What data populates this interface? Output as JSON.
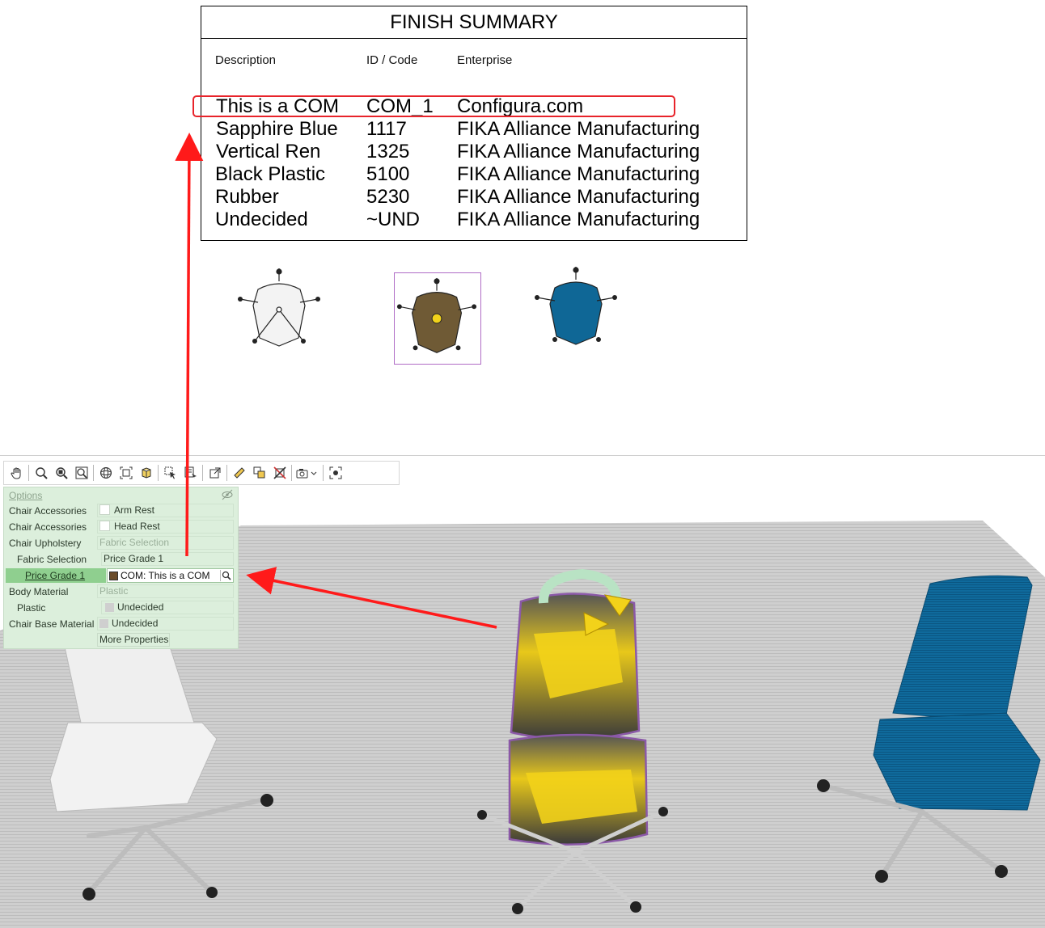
{
  "summary": {
    "title": "FINISH SUMMARY",
    "headers": {
      "description": "Description",
      "id_code": "ID / Code",
      "enterprise": "Enterprise"
    },
    "rows": [
      {
        "description": "This is a COM",
        "id": "COM_1",
        "enterprise": "Configura.com"
      },
      {
        "description": "Sapphire Blue",
        "id": "1117",
        "enterprise": "FIKA Alliance Manufacturing"
      },
      {
        "description": "Vertical Ren",
        "id": "1325",
        "enterprise": "FIKA Alliance Manufacturing"
      },
      {
        "description": "Black Plastic",
        "id": "5100",
        "enterprise": "FIKA Alliance Manufacturing"
      },
      {
        "description": "Rubber",
        "id": "5230",
        "enterprise": "FIKA Alliance Manufacturing"
      },
      {
        "description": "Undecided",
        "id": "~UND",
        "enterprise": "FIKA Alliance Manufacturing"
      }
    ],
    "highlight_color": "#e8232a"
  },
  "thumbnails": [
    {
      "name": "white-chair",
      "color": "#f2f2f2"
    },
    {
      "name": "brown-chair",
      "color": "#6f5a35",
      "selected": true
    },
    {
      "name": "blue-chair",
      "color": "#0f6796"
    }
  ],
  "toolbar": {
    "icons": [
      "hand-icon",
      "zoom-icon",
      "zoom-window-icon",
      "zoom-extents-icon",
      "orbit-icon",
      "fit-selection-icon",
      "view-cube-icon",
      "select-arrow-icon",
      "select-filter-icon",
      "stretch-icon",
      "measure-icon",
      "copy-icon",
      "delete-icon",
      "camera-icon",
      "focus-icon"
    ]
  },
  "options": {
    "header": "Options",
    "rows": [
      {
        "label": "Chair Accessories",
        "value": "Arm Rest",
        "kind": "checkbox"
      },
      {
        "label": "Chair Accessories",
        "value": "Head Rest",
        "kind": "checkbox"
      },
      {
        "label": "Chair Upholstery",
        "value": "Fabric Selection",
        "kind": "muted"
      },
      {
        "label": "Fabric Selection",
        "value": "Price Grade 1",
        "kind": "text"
      },
      {
        "label": "Price Grade 1",
        "value": "COM: This is a COM",
        "kind": "com"
      },
      {
        "label": "Body Material",
        "value": "Plastic",
        "kind": "muted"
      },
      {
        "label": "Plastic",
        "value": "Undecided",
        "kind": "swatch"
      },
      {
        "label": "Chair Base Material",
        "value": "Undecided",
        "kind": "swatch"
      }
    ],
    "more_properties": "More Properties",
    "panel_color": "#dcefdc",
    "selected_color": "#8fcf8f"
  },
  "scene": {
    "rug_color": "#d2d2d2",
    "white_chair_color": "#f0f0f0",
    "blue_chair_color": "#0f6a9c",
    "com_chair_accent": "#f2d21a"
  }
}
